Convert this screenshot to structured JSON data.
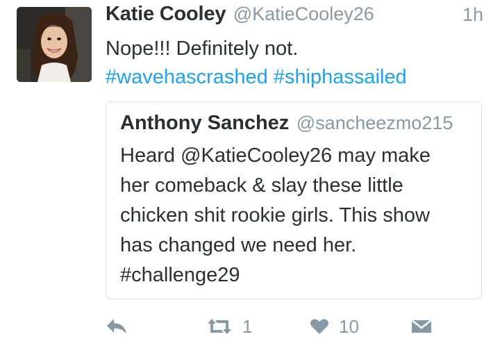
{
  "tweet": {
    "author_name": "Katie Cooley",
    "author_handle": "@KatieCooley26",
    "timestamp": "1h",
    "text_line1": "Nope!!! Definitely not.",
    "hashtag1": "#wavehascrashed",
    "hashtag2": "#shiphassailed",
    "hashtag_color": "#1da1f2"
  },
  "quoted_tweet": {
    "author_name": "Anthony Sanchez",
    "author_handle": "@sancheezmo215",
    "lines": [
      "Heard @KatieCooley26 may make",
      "her comeback & slay these little",
      "chicken shit rookie girls. This show",
      "has changed we need her.",
      "#challenge29"
    ]
  },
  "actions": {
    "reply_icon": "reply-icon",
    "retweet_icon": "retweet-icon",
    "retweet_count": "1",
    "like_icon": "heart-icon",
    "like_count": "10",
    "dm_icon": "envelope-icon"
  }
}
